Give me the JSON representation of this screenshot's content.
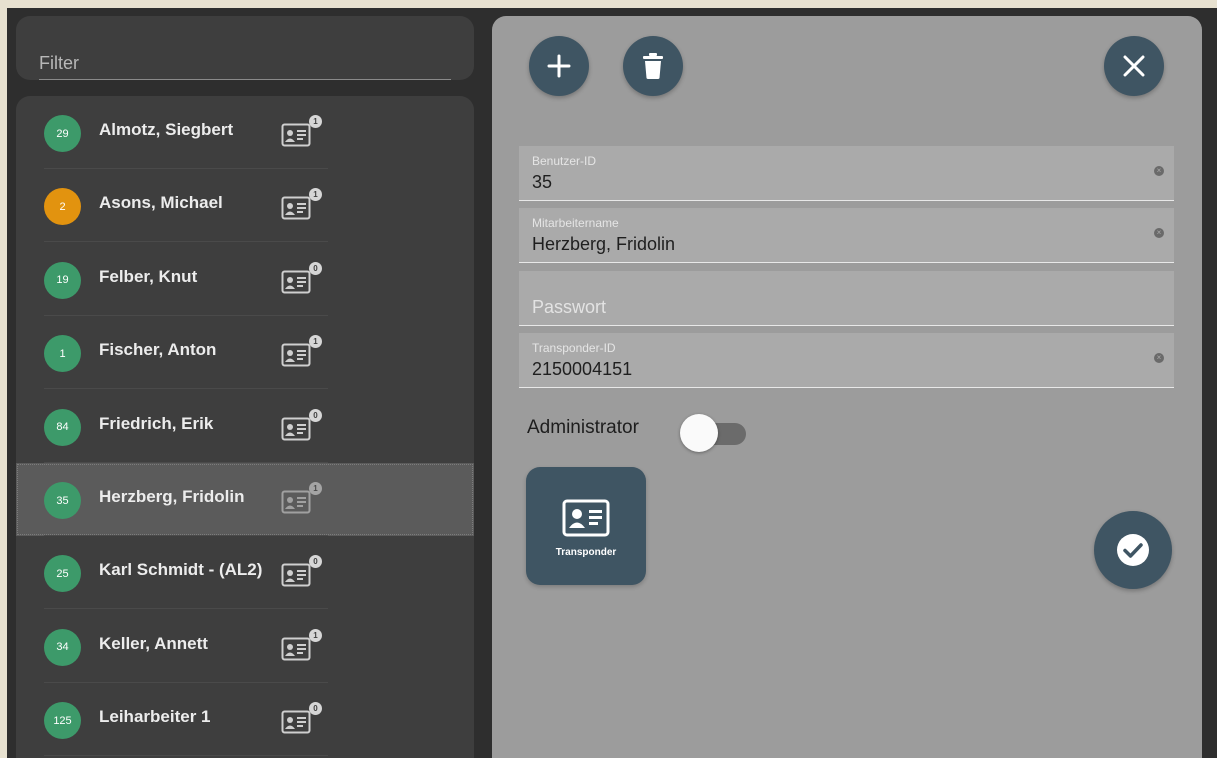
{
  "filter": {
    "placeholder": "Filter",
    "value": ""
  },
  "employees": [
    {
      "badge": "29",
      "badge_color": "#3d9a6a",
      "name": "Almotz, Siegbert",
      "transponder_count": "1",
      "selected": false
    },
    {
      "badge": "2",
      "badge_color": "#e2930f",
      "name": "Asons, Michael",
      "transponder_count": "1",
      "selected": false
    },
    {
      "badge": "19",
      "badge_color": "#3d9a6a",
      "name": "Felber, Knut",
      "transponder_count": "0",
      "selected": false
    },
    {
      "badge": "1",
      "badge_color": "#3d9a6a",
      "name": "Fischer, Anton",
      "transponder_count": "1",
      "selected": false
    },
    {
      "badge": "84",
      "badge_color": "#3d9a6a",
      "name": "Friedrich, Erik",
      "transponder_count": "0",
      "selected": false
    },
    {
      "badge": "35",
      "badge_color": "#3d9a6a",
      "name": "Herzberg, Fridolin",
      "transponder_count": "1",
      "selected": true
    },
    {
      "badge": "25",
      "badge_color": "#3d9a6a",
      "name": "Karl Schmidt - (AL2)",
      "transponder_count": "0",
      "selected": false
    },
    {
      "badge": "34",
      "badge_color": "#3d9a6a",
      "name": "Keller, Annett",
      "transponder_count": "1",
      "selected": false
    },
    {
      "badge": "125",
      "badge_color": "#3d9a6a",
      "name": "Leiharbeiter 1",
      "transponder_count": "0",
      "selected": false
    }
  ],
  "toolbar": {
    "add_icon": "plus-icon",
    "delete_icon": "trash-icon",
    "close_icon": "close-icon"
  },
  "form": {
    "user_id": {
      "label": "Benutzer-ID",
      "value": "35"
    },
    "employee_name": {
      "label": "Mitarbeitername",
      "value": "Herzberg, Fridolin"
    },
    "password": {
      "placeholder": "Passwort",
      "value": ""
    },
    "transponder_id": {
      "label": "Transponder-ID",
      "value": "2150004151"
    },
    "administrator": {
      "label": "Administrator",
      "enabled": false
    }
  },
  "transponder_tile": {
    "label": "Transponder",
    "icon": "id-card-icon"
  },
  "confirm": {
    "icon": "check-icon"
  },
  "colors": {
    "accent": "#3f5563",
    "badge_green": "#3d9a6a",
    "badge_orange": "#e2930f",
    "panel_bg": "#9c9c9c",
    "list_bg": "#3e3e3e"
  }
}
